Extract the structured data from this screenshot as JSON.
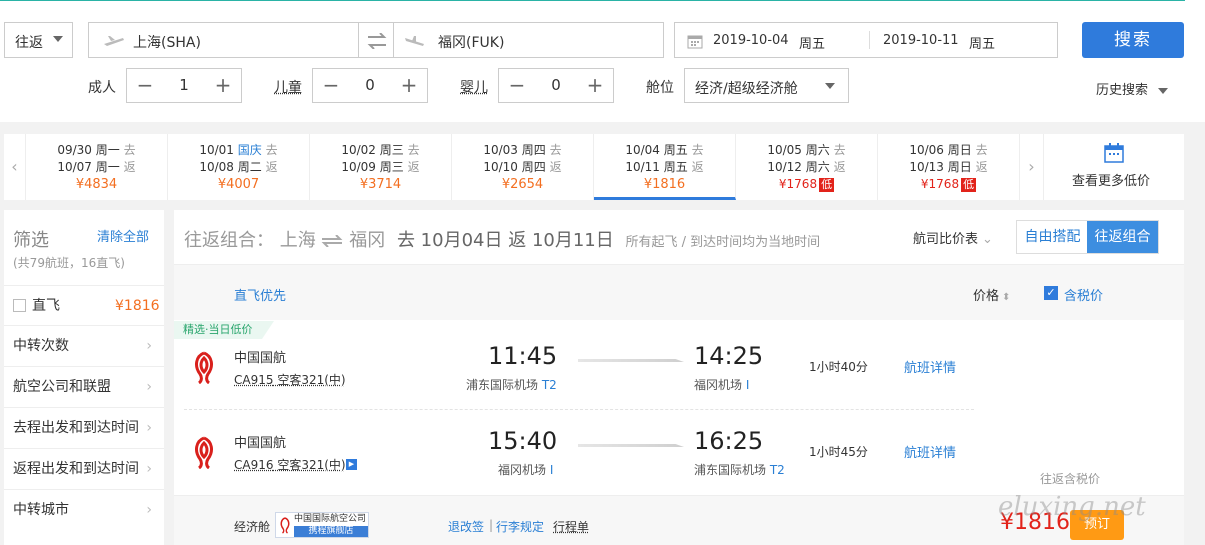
{
  "search": {
    "trip_type": "往返",
    "from": "上海(SHA)",
    "to": "福冈(FUK)",
    "depart_date": "2019-10-04",
    "depart_weekday": "周五",
    "return_date": "2019-10-11",
    "return_weekday": "周五",
    "search_label": "搜索",
    "adult_label": "成人",
    "adult_count": "1",
    "child_label": "儿童",
    "child_count": "0",
    "infant_label": "婴儿",
    "infant_count": "0",
    "cabin_label": "舱位",
    "cabin_value": "经济/超级经济舱",
    "history_label": "历史搜索"
  },
  "calendar": {
    "cells": [
      {
        "d1": "09/30",
        "w1": "周一",
        "t1": "去",
        "d2": "10/07",
        "w2": "周一",
        "t2": "返",
        "price": "¥4834",
        "low": ""
      },
      {
        "d1": "10/01",
        "w1": "国庆",
        "t1": "去",
        "d2": "10/08",
        "w2": "周二",
        "t2": "返",
        "price": "¥4007",
        "low": ""
      },
      {
        "d1": "10/02",
        "w1": "周三",
        "t1": "去",
        "d2": "10/09",
        "w2": "周三",
        "t2": "返",
        "price": "¥3714",
        "low": ""
      },
      {
        "d1": "10/03",
        "w1": "周四",
        "t1": "去",
        "d2": "10/10",
        "w2": "周四",
        "t2": "返",
        "price": "¥2654",
        "low": ""
      },
      {
        "d1": "10/04",
        "w1": "周五",
        "t1": "去",
        "d2": "10/11",
        "w2": "周五",
        "t2": "返",
        "price": "¥1816",
        "low": ""
      },
      {
        "d1": "10/05",
        "w1": "周六",
        "t1": "去",
        "d2": "10/12",
        "w2": "周六",
        "t2": "返",
        "price": "¥1768",
        "low": "低"
      },
      {
        "d1": "10/06",
        "w1": "周日",
        "t1": "去",
        "d2": "10/13",
        "w2": "周日",
        "t2": "返",
        "price": "¥1768",
        "low": "低"
      }
    ],
    "more_label": "查看更多低价"
  },
  "filter": {
    "title": "筛选",
    "clear": "清除全部",
    "summary": "(共79航班，16直飞)",
    "direct_label": "直飞",
    "direct_price": "¥1816",
    "items": [
      "中转次数",
      "航空公司和联盟",
      "去程出发和到达时间",
      "返程出发和到达时间",
      "中转城市"
    ]
  },
  "main": {
    "header_prefix": "往返组合：",
    "from_city": "上海",
    "to_city": "福冈",
    "go_label": "去",
    "go_date": "10月04日",
    "back_label": "返",
    "back_date": "10月11日",
    "note": "所有起飞 / 到达时间均为当地时间",
    "compare": "航司比价表",
    "seg_free": "自由搭配",
    "seg_combo": "往返组合",
    "direct_first": "直飞优先",
    "price_sort": "价格",
    "tax_label": "含税价",
    "badge": "精选·当日低价",
    "flights": [
      {
        "airline": "中国国航",
        "code": "CA915",
        "plane": "空客321(中)",
        "dep": "11:45",
        "dep_airport": "浦东国际机场",
        "dep_term": "T2",
        "arr": "14:25",
        "arr_airport": "福冈机场",
        "arr_term": "I",
        "duration": "1小时40分",
        "detail": "航班详情"
      },
      {
        "airline": "中国国航",
        "code": "CA916",
        "plane": "空客321(中)",
        "dep": "15:40",
        "dep_airport": "福冈机场",
        "dep_term": "I",
        "arr": "16:25",
        "arr_airport": "浦东国际机场",
        "arr_term": "T2",
        "duration": "1小时45分",
        "detail": "航班详情"
      }
    ],
    "cabin": "经济舱",
    "store_line1": "中国国际航空公司",
    "store_line2": "携程旗舰店",
    "refund": "退改签",
    "baggage": "行李规定",
    "itinerary": "行程单",
    "tax_note": "往返含税价",
    "total": "¥1816",
    "book": "预订",
    "watermark": "eluxing.net"
  }
}
